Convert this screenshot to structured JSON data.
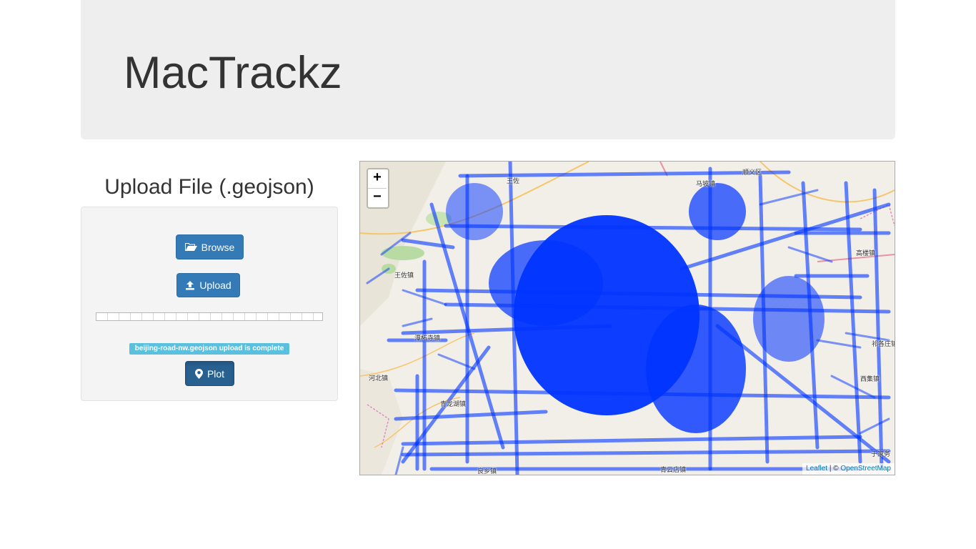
{
  "header": {
    "title": "MacTrackz"
  },
  "upload": {
    "title": "Upload File (.geojson)",
    "browse_label": "Browse",
    "upload_label": "Upload",
    "progress_segments": 20,
    "status_text": "beijing-road-nw.geojson upload is complete",
    "plot_label": "Plot"
  },
  "map": {
    "zoom_in": "+",
    "zoom_out": "−",
    "attribution": {
      "leaflet": "Leaflet",
      "separator": " | © ",
      "osm": "OpenStreetMap"
    },
    "track_color": "#0033ff",
    "places": {
      "p1": "王佐",
      "p2": "高楼镇",
      "p3": "王佐镇",
      "p4": "潭柘寺镇",
      "p5": "河北镇",
      "p6": "青龙湖镇",
      "p7": "良乡镇",
      "p8": "青云店镇",
      "p9": "祁各庄镇",
      "p10": "西集镇",
      "p11": "于家务",
      "p12": "马坡镇",
      "p13": "顺义区"
    }
  },
  "colors": {
    "primary": "#337ab7",
    "info": "#5bc0de",
    "jumbotron": "#eeeeee"
  }
}
